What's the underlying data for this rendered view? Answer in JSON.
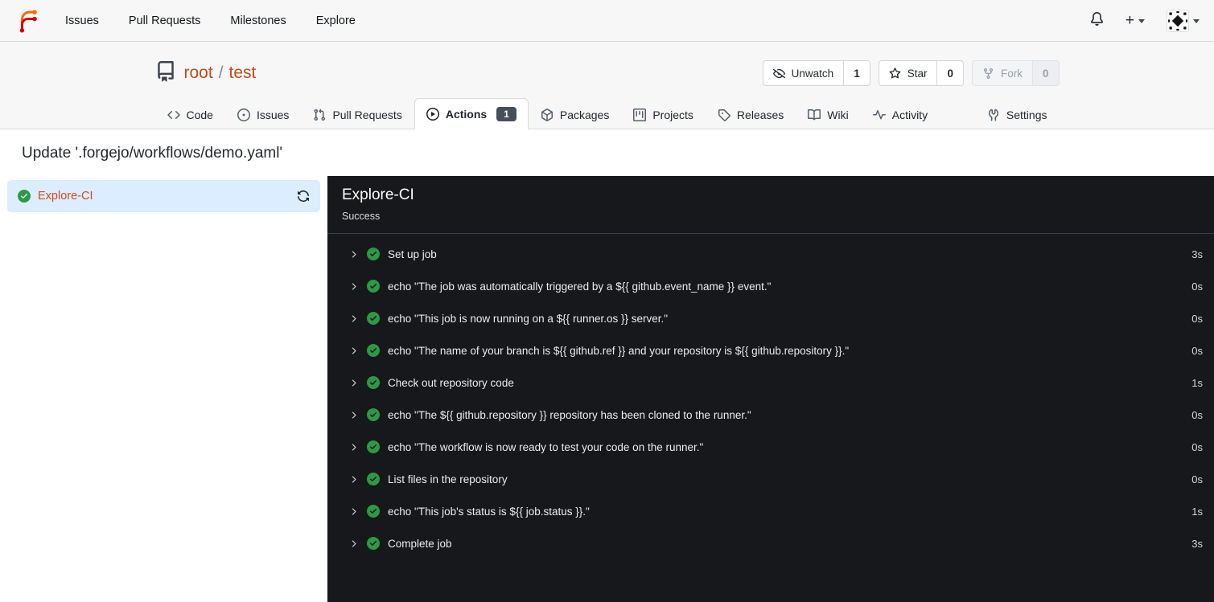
{
  "navbar": {
    "brand_icon": "forgejo-logo",
    "items": [
      {
        "label": "Issues"
      },
      {
        "label": "Pull Requests"
      },
      {
        "label": "Milestones"
      },
      {
        "label": "Explore"
      }
    ],
    "notifications_icon": "bell-icon",
    "create_label": "+",
    "avatar_icon": "identicon-avatar"
  },
  "repo_header": {
    "icon": "repo-icon",
    "owner": "root",
    "separator": "/",
    "name": "test",
    "buttons": [
      {
        "id": "unwatch",
        "icon": "eye-closed-icon",
        "label": "Unwatch",
        "count": "1",
        "disabled": false
      },
      {
        "id": "star",
        "icon": "star-icon",
        "label": "Star",
        "count": "0",
        "disabled": false
      },
      {
        "id": "fork",
        "icon": "fork-icon",
        "label": "Fork",
        "count": "0",
        "disabled": true
      }
    ],
    "tabs": [
      {
        "id": "code",
        "icon": "code-icon",
        "label": "Code",
        "active": false
      },
      {
        "id": "issues",
        "icon": "issue-icon",
        "label": "Issues",
        "active": false
      },
      {
        "id": "pull-requests",
        "icon": "pull-request-icon",
        "label": "Pull Requests",
        "active": false
      },
      {
        "id": "actions",
        "icon": "play-circle-icon",
        "label": "Actions",
        "active": true,
        "badge": "1"
      },
      {
        "id": "packages",
        "icon": "package-icon",
        "label": "Packages",
        "active": false
      },
      {
        "id": "projects",
        "icon": "project-icon",
        "label": "Projects",
        "active": false
      },
      {
        "id": "releases",
        "icon": "tag-icon",
        "label": "Releases",
        "active": false
      },
      {
        "id": "wiki",
        "icon": "book-icon",
        "label": "Wiki",
        "active": false
      },
      {
        "id": "activity",
        "icon": "pulse-icon",
        "label": "Activity",
        "active": false
      }
    ],
    "settings_tab": {
      "id": "settings",
      "icon": "wrench-icon",
      "label": "Settings"
    }
  },
  "page": {
    "title": "Update '.forgejo/workflows/demo.yaml'"
  },
  "sidebar": {
    "jobs": [
      {
        "name": "Explore-CI",
        "status": "success",
        "status_icon": "check-circle-icon",
        "selected": true,
        "rerun_icon": "sync-icon"
      }
    ]
  },
  "job_panel": {
    "title": "Explore-CI",
    "status": "Success",
    "steps": [
      {
        "status_icon": "check-circle-icon",
        "name": "Set up job",
        "duration": "3s"
      },
      {
        "status_icon": "check-circle-icon",
        "name": "echo \"The job was automatically triggered by a ${{ github.event_name }} event.\"",
        "duration": "0s"
      },
      {
        "status_icon": "check-circle-icon",
        "name": "echo \"This job is now running on a ${{ runner.os }} server.\"",
        "duration": "0s"
      },
      {
        "status_icon": "check-circle-icon",
        "name": "echo \"The name of your branch is ${{ github.ref }} and your repository is ${{ github.repository }}.\"",
        "duration": "0s"
      },
      {
        "status_icon": "check-circle-icon",
        "name": "Check out repository code",
        "duration": "1s"
      },
      {
        "status_icon": "check-circle-icon",
        "name": "echo \"The ${{ github.repository }} repository has been cloned to the runner.\"",
        "duration": "0s"
      },
      {
        "status_icon": "check-circle-icon",
        "name": "echo \"The workflow is now ready to test your code on the runner.\"",
        "duration": "0s"
      },
      {
        "status_icon": "check-circle-icon",
        "name": "List files in the repository",
        "duration": "0s"
      },
      {
        "status_icon": "check-circle-icon",
        "name": "echo \"This job's status is ${{ job.status }}.\"",
        "duration": "1s"
      },
      {
        "status_icon": "check-circle-icon",
        "name": "Complete job",
        "duration": "3s"
      }
    ]
  },
  "colors": {
    "accent_link": "#c7481c",
    "success_green": "#2c9a44",
    "panel_background": "#17181b",
    "selected_job_background": "#dcedff",
    "header_background": "#f7f7f8",
    "badge_background": "#454f5e",
    "logo_orange": "#ff6600",
    "logo_red": "#d40000"
  }
}
